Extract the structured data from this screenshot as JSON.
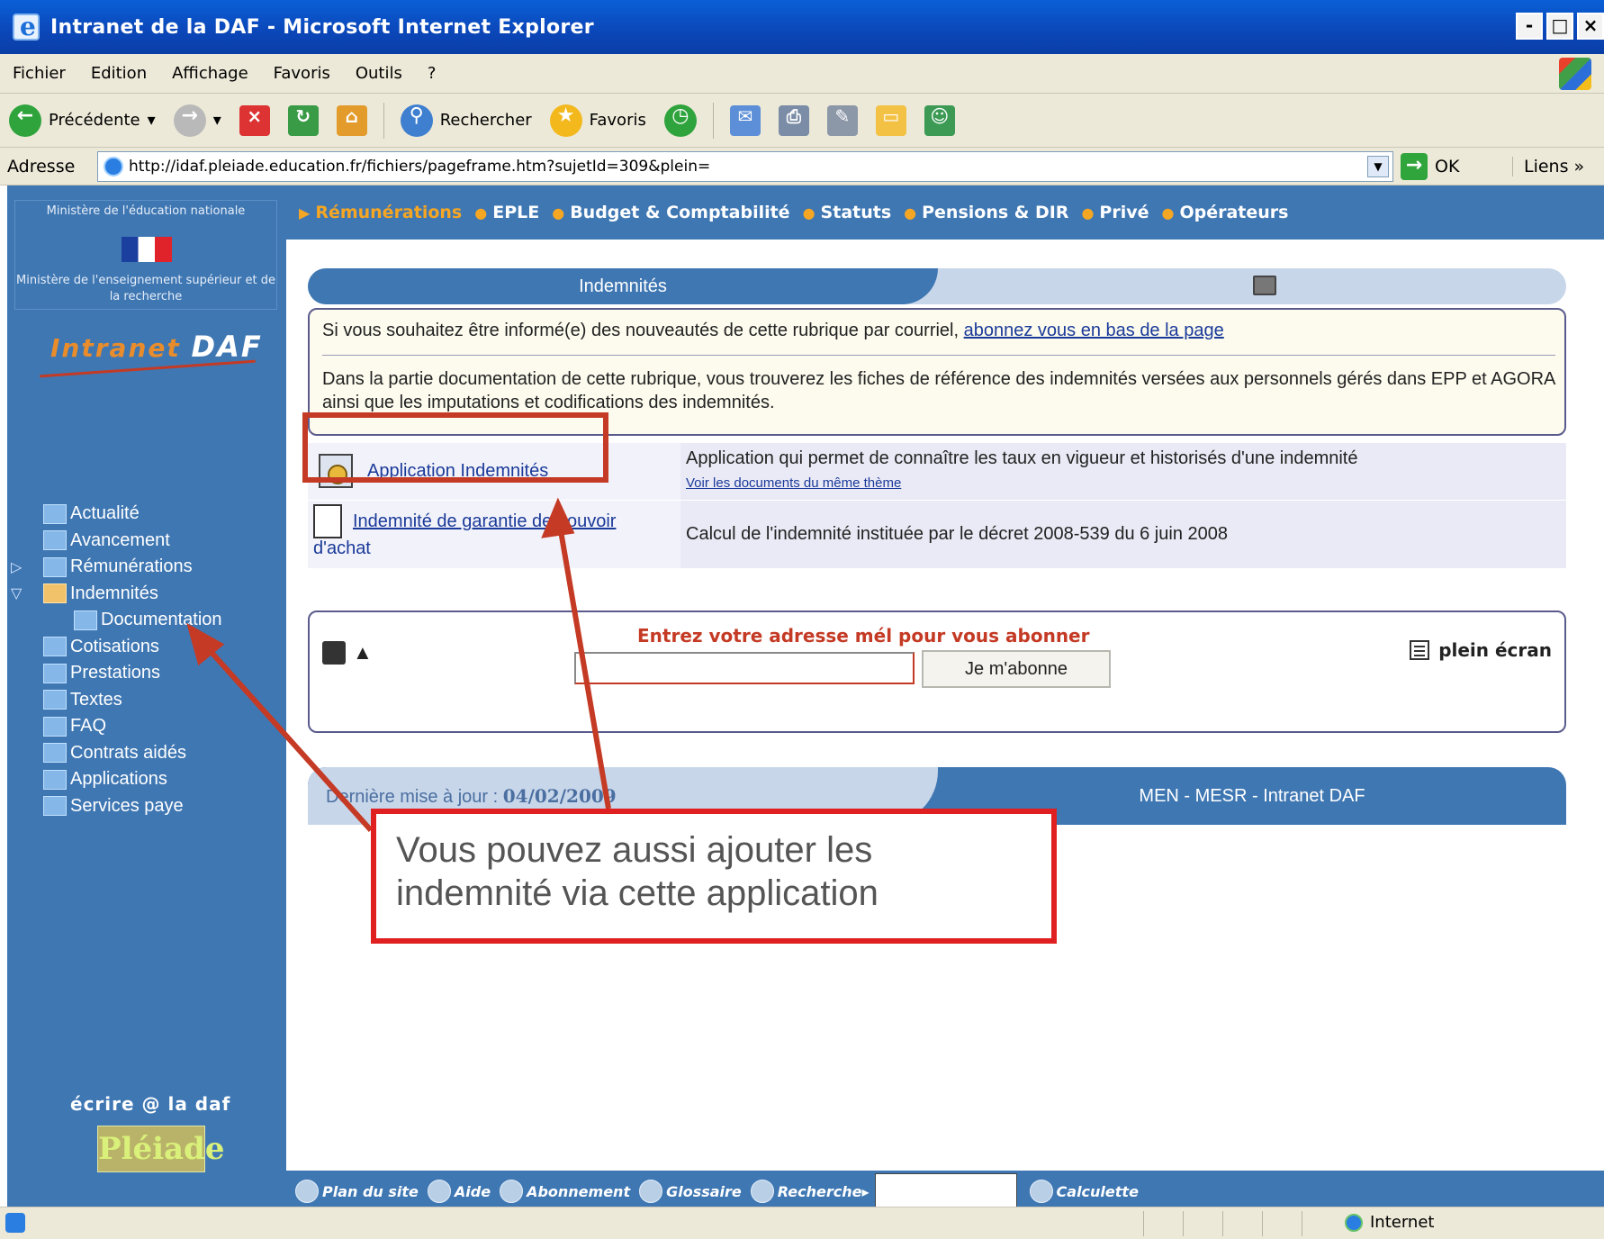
{
  "window": {
    "title": "Intranet de la DAF - Microsoft Internet Explorer",
    "controls": [
      "-",
      "□",
      "×"
    ]
  },
  "menu": [
    "Fichier",
    "Edition",
    "Affichage",
    "Favoris",
    "Outils",
    "?"
  ],
  "toolbar": {
    "back": "Précédente",
    "search": "Rechercher",
    "favorites": "Favoris"
  },
  "address": {
    "label": "Adresse",
    "url": "http://idaf.pleiade.education.fr/fichiers/pageframe.htm?sujetId=309&plein=",
    "go": "OK",
    "links": "Liens »"
  },
  "sidebar": {
    "ministry_1": "Ministère de l'éducation nationale",
    "ministry_2": "Ministère de l'enseignement supérieur et de la recherche",
    "logo_a": "Intranet ",
    "logo_b": "DAF",
    "items": [
      {
        "label": "Actualité"
      },
      {
        "label": "Avancement"
      },
      {
        "label": "Rémunérations"
      },
      {
        "label": "Indemnités"
      },
      {
        "label": "Documentation"
      },
      {
        "label": "Cotisations"
      },
      {
        "label": "Prestations"
      },
      {
        "label": "Textes"
      },
      {
        "label": "FAQ"
      },
      {
        "label": "Contrats aidés"
      },
      {
        "label": "Applications"
      },
      {
        "label": "Services paye"
      }
    ],
    "ecrire": "écrire @ la daf",
    "pleiade": "Pléiade"
  },
  "topnav": [
    "Rémunérations",
    "EPLE",
    "Budget & Comptabilité",
    "Statuts",
    "Pensions & DIR",
    "Privé",
    "Opérateurs"
  ],
  "page": {
    "tab_title": "Indemnités",
    "info_line1": "Si vous souhaitez être informé(e) des nouveautés de cette rubrique par courriel, ",
    "info_link": "abonnez vous en bas de la page",
    "info_line2": "Dans la partie documentation de cette rubrique, vous trouverez les fiches de référence des indemnités versées aux personnels gérés dans EPP et AGORA ainsi que les imputations et codifications des indemnités.",
    "apps": [
      {
        "link": "Application Indemnités",
        "desc": "Application qui permet de connaître les taux en vigueur et historisés d'une indemnité",
        "sub": "Voir les documents du même thème"
      },
      {
        "link_a": "Indemnité de garantie de pouvoir",
        "link_b": "d'achat",
        "desc": "Calcul de l'indemnité instituée par le décret 2008-539 du 6 juin 2008"
      }
    ],
    "subscribe_label": "Entrez votre adresse mél pour vous abonner",
    "subscribe_button": "Je m'abonne",
    "fullscreen": "plein écran",
    "updated_label": "Dernière mise à jour : ",
    "updated_date": "04/02/2009",
    "footer_right": "MEN - MESR - Intranet DAF"
  },
  "bottom_tools": [
    "Plan du site",
    "Aide",
    "Abonnement",
    "Glossaire",
    "Recherche",
    "Calculette"
  ],
  "status": {
    "zone": "Internet"
  },
  "annotation": {
    "callout": "Vous pouvez aussi ajouter les indemnité via cette application"
  },
  "colors": {
    "sidebar_blue": "#3f77b3",
    "accent_orange": "#f5a623",
    "annotation_red": "#e02020"
  }
}
